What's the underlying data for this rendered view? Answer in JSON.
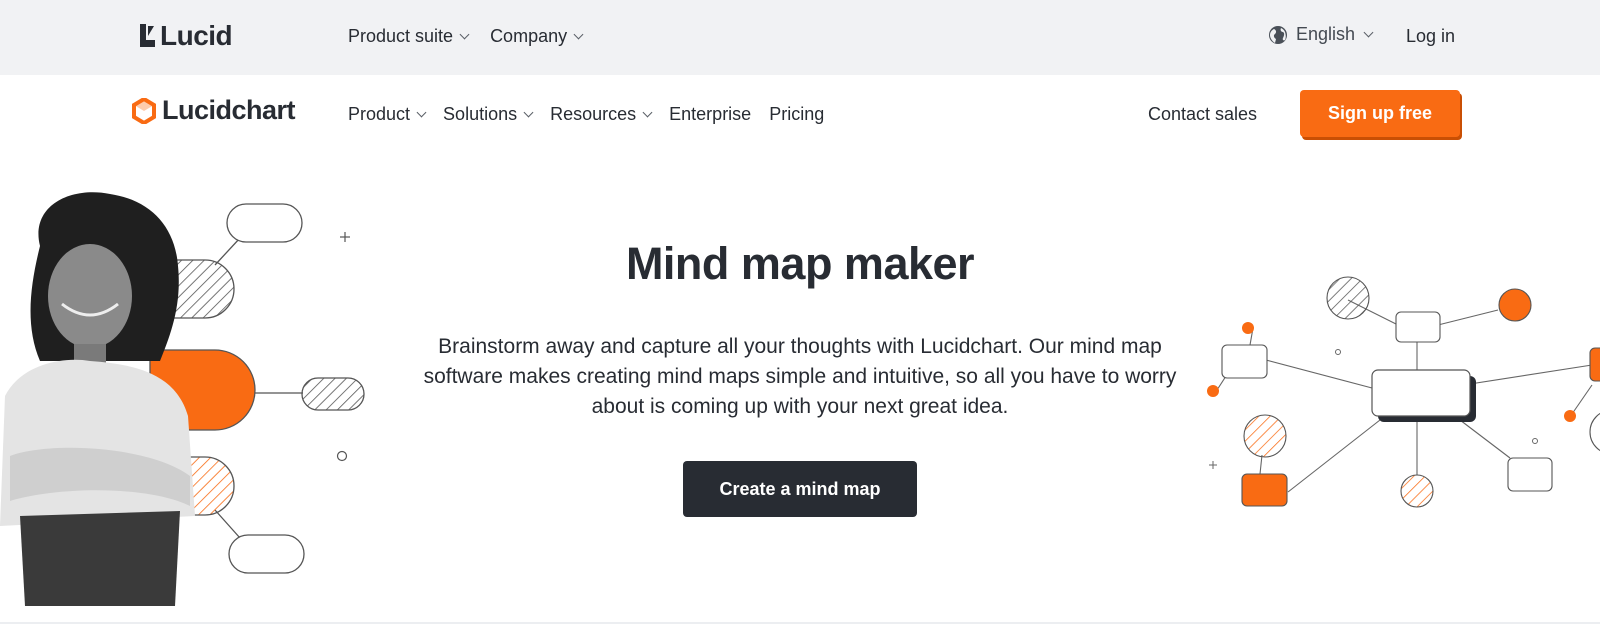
{
  "topbar": {
    "brand": "Lucid",
    "nav": [
      {
        "label": "Product suite"
      },
      {
        "label": "Company"
      }
    ],
    "language": "English",
    "login": "Log in"
  },
  "mainnav": {
    "brand": "Lucidchart",
    "items": [
      {
        "label": "Product",
        "dropdown": true
      },
      {
        "label": "Solutions",
        "dropdown": true
      },
      {
        "label": "Resources",
        "dropdown": true
      },
      {
        "label": "Enterprise",
        "dropdown": false
      },
      {
        "label": "Pricing",
        "dropdown": false
      }
    ],
    "contact": "Contact sales",
    "signup": "Sign up free"
  },
  "hero": {
    "title": "Mind map maker",
    "description": "Brainstorm away and capture all your thoughts with Lucidchart. Our mind map software makes creating mind maps simple and intuitive, so all you have to worry about is coming up with your next great idea.",
    "cta": "Create a mind map"
  },
  "colors": {
    "accent": "#f96b13",
    "dark": "#282c33",
    "topbar_bg": "#f1f2f4"
  },
  "icons": {
    "globe": "globe-icon",
    "chevron": "chevron-down-icon",
    "lucid_logo": "lucid-logo-icon",
    "lucidchart_logo": "lucidchart-logo-icon"
  }
}
